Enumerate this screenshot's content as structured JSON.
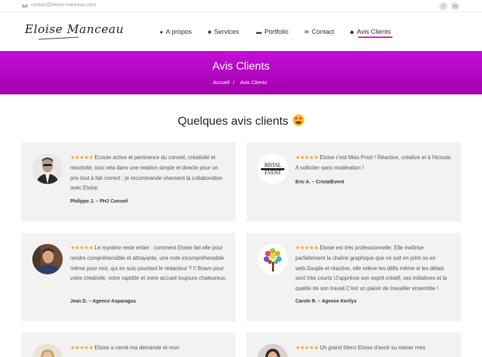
{
  "topbar": {
    "email": "contact@eloise-manceau.com",
    "social": [
      {
        "icon": "twitter-icon",
        "glyph": "t"
      },
      {
        "icon": "linkedin-icon",
        "glyph": "in"
      }
    ]
  },
  "header": {
    "logo": "Eloise Manceau",
    "nav": [
      {
        "label": "A propos",
        "icon": "user-icon",
        "glyph": "👤"
      },
      {
        "label": "Services",
        "icon": "cubes-icon",
        "glyph": "⬢"
      },
      {
        "label": "Portfolio",
        "icon": "folder-icon",
        "glyph": "▬"
      },
      {
        "label": "Contact",
        "icon": "envelope-icon",
        "glyph": "✉"
      },
      {
        "label": "Avis Clients",
        "icon": "comments-icon",
        "glyph": "💬",
        "active": true
      }
    ]
  },
  "banner": {
    "title": "Avis Clients",
    "breadcrumb": {
      "home": "Accueil",
      "separator": "/",
      "current": "Avis Clients"
    }
  },
  "section": {
    "title": "Quelques avis clients"
  },
  "reviews": [
    {
      "stars": "★★★★★",
      "text": "Ecoute active et pertinence du conseil, créativité et réactivité, tout cela dans une relation simple et directe pour un prix tout à fait correct ; je recommande vivement la collaboration avec Eloise.",
      "author": "Philippe J. – PHJ Conseil"
    },
    {
      "stars": "★★★★★",
      "text": "Eloise c'est Miss Prezi ! Réactive, créative et à l'écoute. A solliciter sans modération !",
      "author": "Eric A. – CristalEvent",
      "logo_text": "RISTAL EVENT"
    },
    {
      "stars": "★★★★★",
      "text": "Le mystère reste entier : comment Eloise fait elle pour rendre compréhensible et attrayante, une note incompréhensible même pour moi, qui en suis pourtant le rédacteur ? !! Bravo pour votre créativité, votre rapidité et votre accueil toujours chaleureux.",
      "author": "Jean D. – Agence Asparagus"
    },
    {
      "stars": "★★★★★",
      "text": "Eloise est très professionnelle. Elle maîtrise parfaitement la chaîne graphique que ce soit en print ou en web.Souple et réactive, elle relève les défis même si les délais sont très courts !J'apprécie son esprit créatif, ses initiatives et la qualité de son travail.C'est un plaisir de travailler ensemble !",
      "author": "Carole R. – Agence Kerilys"
    },
    {
      "stars": "★★★★★",
      "text": "Eloise a cerné ma demande et mon",
      "author": ""
    },
    {
      "stars": "★★★★★",
      "text": "Un grand Merci Eloise d'avoir su mener mes",
      "author": ""
    }
  ],
  "colors": {
    "accent": "#c40ed8",
    "stars": "#f0a41f",
    "card": "#f2f2f2"
  }
}
